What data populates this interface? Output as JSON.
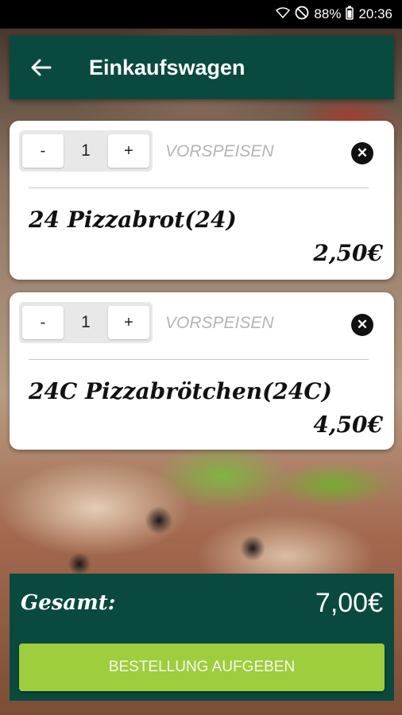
{
  "status_bar": {
    "wifi_icon": "wifi-icon",
    "dnd_icon": "do-not-disturb-icon",
    "battery": "88%",
    "battery_icon": "battery-icon",
    "time": "20:36"
  },
  "app_bar": {
    "back_icon": "arrow-left-icon",
    "title": "Einkaufswagen"
  },
  "cart": {
    "items": [
      {
        "quantity": "1",
        "minus_label": "-",
        "plus_label": "+",
        "category": "VORSPEISEN",
        "name": "24 Pizzabrot(24)",
        "price": "2,50€"
      },
      {
        "quantity": "1",
        "minus_label": "-",
        "plus_label": "+",
        "category": "VORSPEISEN",
        "name": "24C Pizzabrötchen(24C)",
        "price": "4,50€"
      }
    ]
  },
  "footer": {
    "total_label": "Gesamt:",
    "total_value": "7,00€",
    "order_button": "BESTELLUNG AUFGEBEN"
  },
  "colors": {
    "primary": "#0a4a3e",
    "accent": "#9ecd3e"
  }
}
